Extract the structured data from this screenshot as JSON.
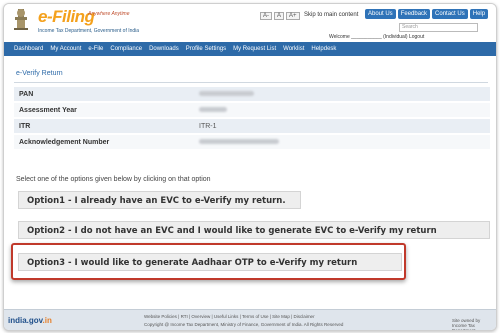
{
  "header": {
    "logo_text": "e-Filing",
    "logo_tagline": "Anywhere Anytime",
    "logo_sub": "Income Tax Department, Government of India",
    "a11y_buttons": [
      "A-",
      "A",
      "A+"
    ],
    "skip_link": "Skip to main content",
    "top_links": [
      "About Us",
      "Feedback",
      "Contact Us",
      "Help"
    ],
    "search_placeholder": "Search",
    "welcome_text": "Welcome ___________ (Individual) Logout"
  },
  "nav": {
    "items": [
      "Dashboard",
      "My Account",
      "e-File",
      "Compliance",
      "Downloads",
      "Profile Settings",
      "My Request List",
      "Worklist",
      "Helpdesk"
    ]
  },
  "page": {
    "title": "e-Verify Return",
    "rows": [
      {
        "label": "PAN",
        "value": ""
      },
      {
        "label": "Assessment Year",
        "value": ""
      },
      {
        "label": "ITR",
        "value": "ITR-1"
      },
      {
        "label": "Acknowledgement Number",
        "value": ""
      }
    ],
    "instruction": "Select one of the options given below by clicking on that option",
    "options": [
      "Option1 - I already have an EVC to e-Verify my return.",
      "Option2 - I do not have an EVC and I would like to generate EVC to e-Verify my return",
      "Option3 - I would like to generate Aadhaar OTP to e-Verify my return"
    ]
  },
  "footer": {
    "india_logo_main": "india.gov",
    "india_logo_suffix": ".in",
    "links": "Website Policies | RTI | Overview | Useful Links | Terms of Use | Site Map | Disclaimer",
    "copyright": "Copyright @ Income Tax Department, Ministry of Finance, Government of India. All Rights Reserved",
    "right": "Site owned by Income Tax Department"
  },
  "colors": {
    "nav_bg": "#2d6aa8",
    "highlight_border": "#c0392b",
    "logo_orange": "#f4a11d"
  }
}
